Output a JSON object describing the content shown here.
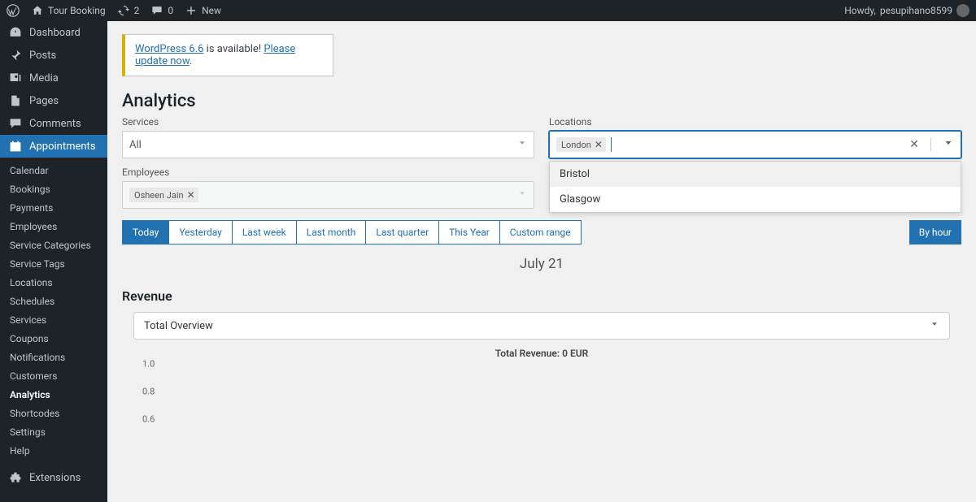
{
  "adminbar": {
    "site_name": "Tour Booking",
    "updates_count": "2",
    "comments_count": "0",
    "new_label": "New",
    "howdy_prefix": "Howdy, ",
    "username": "pesupihano8599"
  },
  "sidebar": {
    "main": [
      {
        "key": "dashboard",
        "label": "Dashboard",
        "icon": "dashboard"
      },
      {
        "key": "posts",
        "label": "Posts",
        "icon": "pin"
      },
      {
        "key": "media",
        "label": "Media",
        "icon": "media"
      },
      {
        "key": "pages",
        "label": "Pages",
        "icon": "pages"
      },
      {
        "key": "comments",
        "label": "Comments",
        "icon": "comments"
      },
      {
        "key": "appointments",
        "label": "Appointments",
        "icon": "calendar"
      }
    ],
    "subs": [
      {
        "key": "calendar",
        "label": "Calendar"
      },
      {
        "key": "bookings",
        "label": "Bookings"
      },
      {
        "key": "payments",
        "label": "Payments"
      },
      {
        "key": "employees",
        "label": "Employees"
      },
      {
        "key": "service-categories",
        "label": "Service Categories"
      },
      {
        "key": "service-tags",
        "label": "Service Tags"
      },
      {
        "key": "locations",
        "label": "Locations"
      },
      {
        "key": "schedules",
        "label": "Schedules"
      },
      {
        "key": "services",
        "label": "Services"
      },
      {
        "key": "coupons",
        "label": "Coupons"
      },
      {
        "key": "notifications",
        "label": "Notifications"
      },
      {
        "key": "customers",
        "label": "Customers"
      },
      {
        "key": "analytics",
        "label": "Analytics",
        "current": true
      },
      {
        "key": "shortcodes",
        "label": "Shortcodes"
      },
      {
        "key": "settings",
        "label": "Settings"
      },
      {
        "key": "help",
        "label": "Help"
      }
    ],
    "extensions_label": "Extensions"
  },
  "notice": {
    "version_link": "WordPress 6.6",
    "middle_text": " is available! ",
    "update_link": "Please update now",
    "tail": "."
  },
  "page": {
    "title": "Analytics"
  },
  "filters": {
    "services_label": "Services",
    "services_value": "All",
    "locations_label": "Locations",
    "locations_chip": "London",
    "locations_options": [
      "Bristol",
      "Glasgow"
    ],
    "employees_label": "Employees",
    "employees_chip": "Osheen Jain"
  },
  "ranges": [
    "Today",
    "Yesterday",
    "Last week",
    "Last month",
    "Last quarter",
    "This Year",
    "Custom range"
  ],
  "active_range": "Today",
  "byhour_label": "By hour",
  "date_heading": "July 21",
  "revenue": {
    "title": "Revenue",
    "select_value": "Total Overview",
    "chart_title": "Total Revenue: 0 EUR"
  },
  "chart_data": {
    "type": "bar",
    "title": "Total Revenue: 0 EUR",
    "categories": [],
    "values": [],
    "xlabel": "",
    "ylabel": "",
    "ylim": [
      0,
      1.0
    ],
    "y_ticks": [
      1.0,
      0.8,
      0.6
    ]
  }
}
